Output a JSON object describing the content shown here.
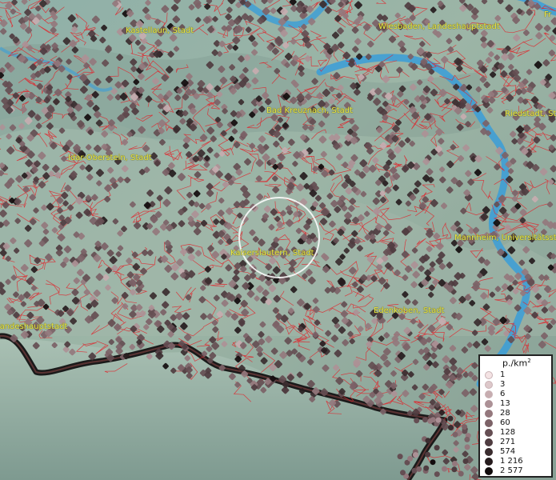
{
  "map": {
    "places": [
      {
        "name": "Kastellaun, Stadt"
      },
      {
        "name": "Wiesbaden, Landeshauptstadt"
      },
      {
        "name": "Bad Kreuznach, Stadt"
      },
      {
        "name": "Riedstadt, Stadt"
      },
      {
        "name": "Idar-Oberstein, Stadt"
      },
      {
        "name": "Kaiserslautern, Stadt"
      },
      {
        "name": "Mannheim, Universitätsstadt"
      },
      {
        "name": "Edenkoben, Stadt"
      },
      {
        "name": "Landeshauptstadt"
      },
      {
        "name": "Fr"
      }
    ],
    "colors": {
      "boundary": "#e0242b",
      "river": "#3a9ed8",
      "land": "#8fa89a",
      "border_line": "#1a1a1a",
      "label": "#e8e64a"
    }
  },
  "legend": {
    "title": "p./km",
    "title_sup": "2",
    "items": [
      {
        "label": "1",
        "color": "#f4e3e4"
      },
      {
        "label": "3",
        "color": "#ddc8ca"
      },
      {
        "label": "6",
        "color": "#c7adb0"
      },
      {
        "label": "13",
        "color": "#ac9196"
      },
      {
        "label": "28",
        "color": "#94787d"
      },
      {
        "label": "60",
        "color": "#7c6267"
      },
      {
        "label": "128",
        "color": "#654e53"
      },
      {
        "label": "271",
        "color": "#4f3c40"
      },
      {
        "label": "574",
        "color": "#3a2c2f"
      },
      {
        "label": "1 216",
        "color": "#261c1e"
      },
      {
        "label": "2 577",
        "color": "#120c0d"
      }
    ]
  }
}
